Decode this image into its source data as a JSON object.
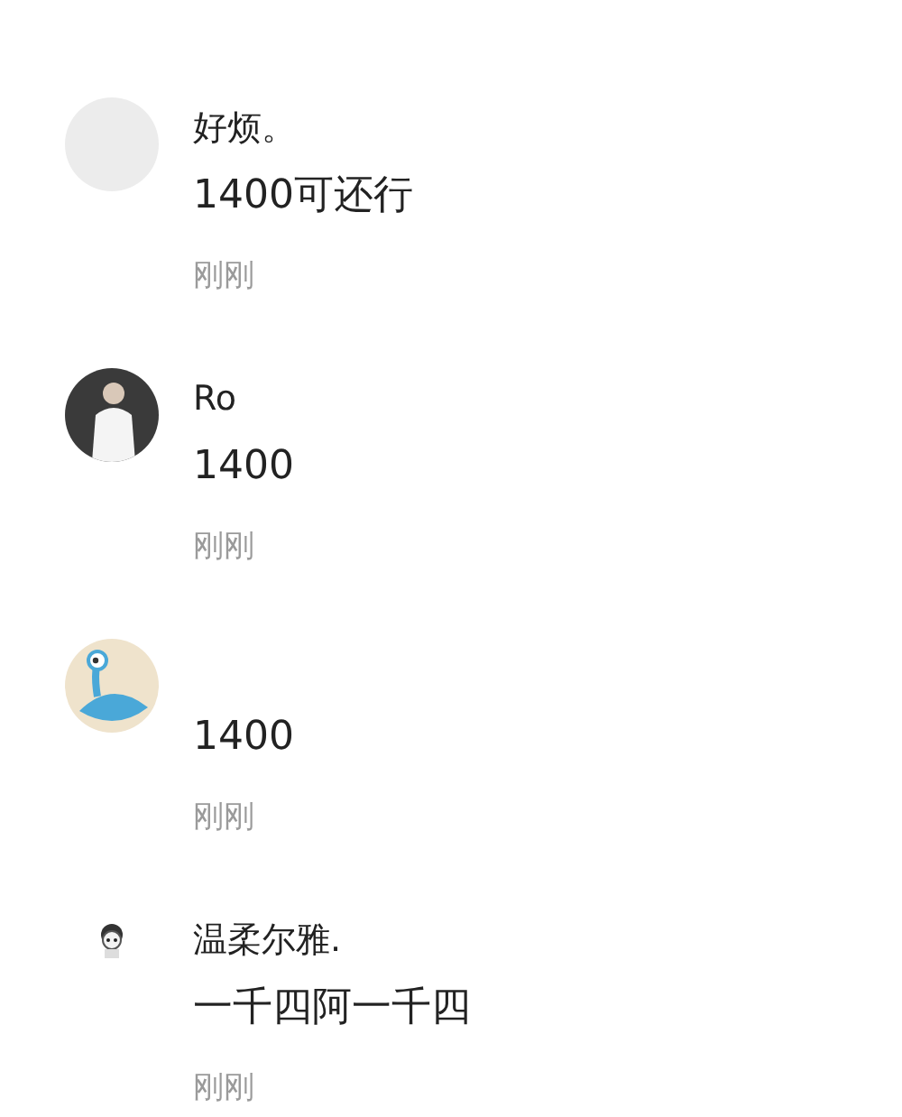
{
  "comments": [
    {
      "avatar": {
        "kind": "blank"
      },
      "name": "好烦。",
      "text": "1400可还行",
      "time": "刚刚"
    },
    {
      "avatar": {
        "kind": "photo"
      },
      "name": "Ro",
      "text": "1400",
      "time": "刚刚"
    },
    {
      "avatar": {
        "kind": "alien"
      },
      "text": "1400",
      "time": "刚刚"
    },
    {
      "avatar": {
        "kind": "small"
      },
      "name": "温柔尔雅.",
      "text": "一千四阿一千四",
      "time": "刚刚"
    }
  ]
}
